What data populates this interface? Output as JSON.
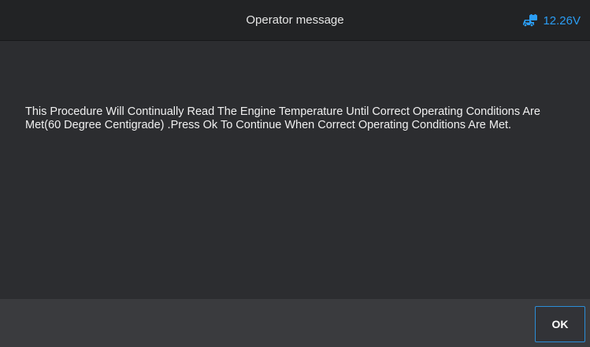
{
  "header": {
    "title": "Operator message",
    "voltage": "12.26V",
    "status_icon": "car-battery-icon",
    "accent_color": "#2b9df4"
  },
  "main": {
    "message": "This Procedure Will Continually Read The Engine Temperature Until Correct Operating Conditions Are Met(60 Degree Centigrade) .Press Ok To Continue When Correct Operating Conditions Are Met."
  },
  "footer": {
    "ok_label": "OK"
  }
}
